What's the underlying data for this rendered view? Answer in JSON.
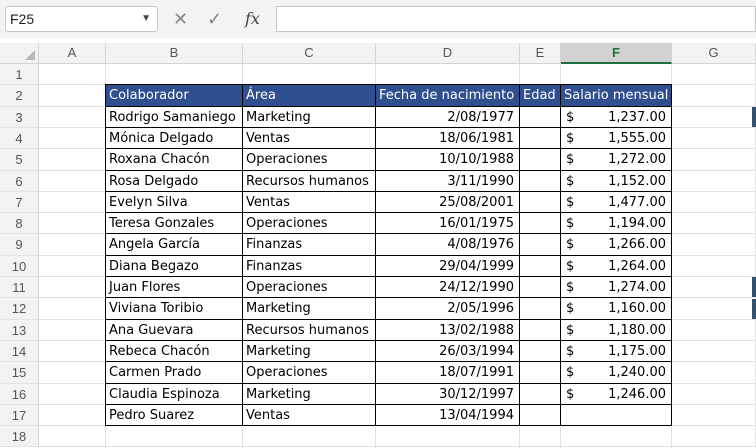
{
  "name_box": {
    "value": "F25"
  },
  "formula_bar": {
    "fx_label": "fx",
    "value": ""
  },
  "selected": {
    "column": "F"
  },
  "columns": [
    "A",
    "B",
    "C",
    "D",
    "E",
    "F",
    "G"
  ],
  "rows": [
    "1",
    "2",
    "3",
    "4",
    "5",
    "6",
    "7",
    "8",
    "9",
    "10",
    "11",
    "12",
    "13",
    "14",
    "15",
    "16",
    "17",
    "18"
  ],
  "table": {
    "headers": [
      "Colaborador",
      "Área",
      "Fecha de nacimiento",
      "Edad",
      "Salario mensual"
    ],
    "currency_symbol": "$",
    "rows": [
      {
        "name": "Rodrigo Samaniego",
        "area": "Marketing",
        "dob": "2/08/1977",
        "salary": "1,237.00"
      },
      {
        "name": "Mónica Delgado",
        "area": "Ventas",
        "dob": "18/06/1981",
        "salary": "1,555.00"
      },
      {
        "name": "Roxana Chacón",
        "area": "Operaciones",
        "dob": "10/10/1988",
        "salary": "1,272.00"
      },
      {
        "name": "Rosa Delgado",
        "area": "Recursos humanos",
        "dob": "3/11/1990",
        "salary": "1,152.00"
      },
      {
        "name": "Evelyn Silva",
        "area": "Ventas",
        "dob": "25/08/2001",
        "salary": "1,477.00"
      },
      {
        "name": "Teresa Gonzales",
        "area": "Operaciones",
        "dob": "16/01/1975",
        "salary": "1,194.00"
      },
      {
        "name": "Angela García",
        "area": "Finanzas",
        "dob": "4/08/1976",
        "salary": "1,266.00"
      },
      {
        "name": "Diana Begazo",
        "area": "Finanzas",
        "dob": "29/04/1999",
        "salary": "1,264.00"
      },
      {
        "name": "Juan Flores",
        "area": "Operaciones",
        "dob": "24/12/1990",
        "salary": "1,274.00"
      },
      {
        "name": "Viviana Toribio",
        "area": "Marketing",
        "dob": "2/05/1996",
        "salary": "1,160.00"
      },
      {
        "name": "Ana Guevara",
        "area": "Recursos humanos",
        "dob": "13/02/1988",
        "salary": "1,180.00"
      },
      {
        "name": "Rebeca Chacón",
        "area": "Marketing",
        "dob": "26/03/1994",
        "salary": "1,175.00"
      },
      {
        "name": "Carmen Prado",
        "area": "Operaciones",
        "dob": "18/07/1991",
        "salary": "1,240.00"
      },
      {
        "name": "Claudia Espinoza",
        "area": "Marketing",
        "dob": "30/12/1997",
        "salary": "1,246.00"
      },
      {
        "name": "Pedro Suarez",
        "area": "Ventas",
        "dob": "13/04/1994",
        "salary": ""
      }
    ]
  },
  "colors": {
    "header_fill": "#2f4f8f",
    "header_text": "#ffffff",
    "selected_col": "#1f6e43"
  }
}
